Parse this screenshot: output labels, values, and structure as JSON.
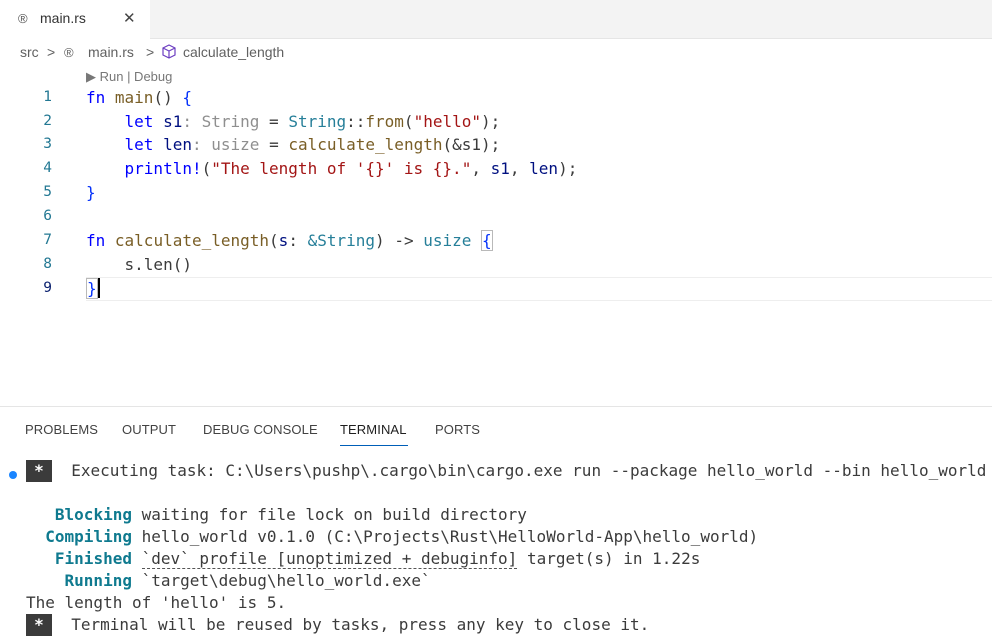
{
  "tab": {
    "icon": "rust-icon",
    "filename": "main.rs",
    "close": "✕"
  },
  "breadcrumb": {
    "folder": "src",
    "file": "main.rs",
    "symbol": "calculate_length",
    "sep": ">"
  },
  "codelens": "▶ Run | Debug",
  "editor": {
    "line_numbers": [
      "1",
      "2",
      "3",
      "4",
      "5",
      "6",
      "7",
      "8",
      "9"
    ],
    "tokens": {
      "fn": "fn",
      "main": "main",
      "parens": "()",
      "lbrace": "{",
      "rbrace": "}",
      "let": "let",
      "s1": "s1",
      "type_hint_string": ": String",
      "eq": "=",
      "String": "String",
      "colons": "::",
      "from": "from",
      "hello_str": "\"hello\"",
      "len": "len",
      "type_hint_usize": ": usize",
      "calculate_length": "calculate_length",
      "ref_s1": "&s1",
      "println": "println!",
      "fmt_str": "\"The length of '{}' is {}.\"",
      "s": "s",
      "colon": ":",
      "amp_String": "&String",
      "arrow": "->",
      "usize": "usize",
      "s_len": "s.len()",
      "semi": ";",
      "comma": ",",
      "lparen": "(",
      "rparen": ")"
    }
  },
  "panel": {
    "tabs": [
      "PROBLEMS",
      "OUTPUT",
      "DEBUG CONSOLE",
      "TERMINAL",
      "PORTS"
    ],
    "active_tab": "TERMINAL",
    "terminal": {
      "badge": "*",
      "task": "Executing task: C:\\Users\\pushp\\.cargo\\bin\\cargo.exe run --package hello_world --bin hello_world",
      "blocking_label": "Blocking",
      "blocking_text": "waiting for file lock on build directory",
      "compiling_label": "Compiling",
      "compiling_text": "hello_world v0.1.0 (C:\\Projects\\Rust\\HelloWorld-App\\hello_world)",
      "finished_label": "Finished",
      "finished_profile": "`dev` profile [unoptimized + debuginfo]",
      "finished_text": "target(s) in 1.22s",
      "running_label": "Running",
      "running_text": "`target\\debug\\hello_world.exe`",
      "output": "The length of 'hello' is 5.",
      "reuse": "Terminal will be reused by tasks, press any key to close it."
    }
  },
  "colors": {
    "keyword": "#0000ff",
    "function": "#795e26",
    "type": "#267f99",
    "string": "#a31515",
    "cargo_status": "#0f7a8f",
    "accent": "#005fb8"
  }
}
